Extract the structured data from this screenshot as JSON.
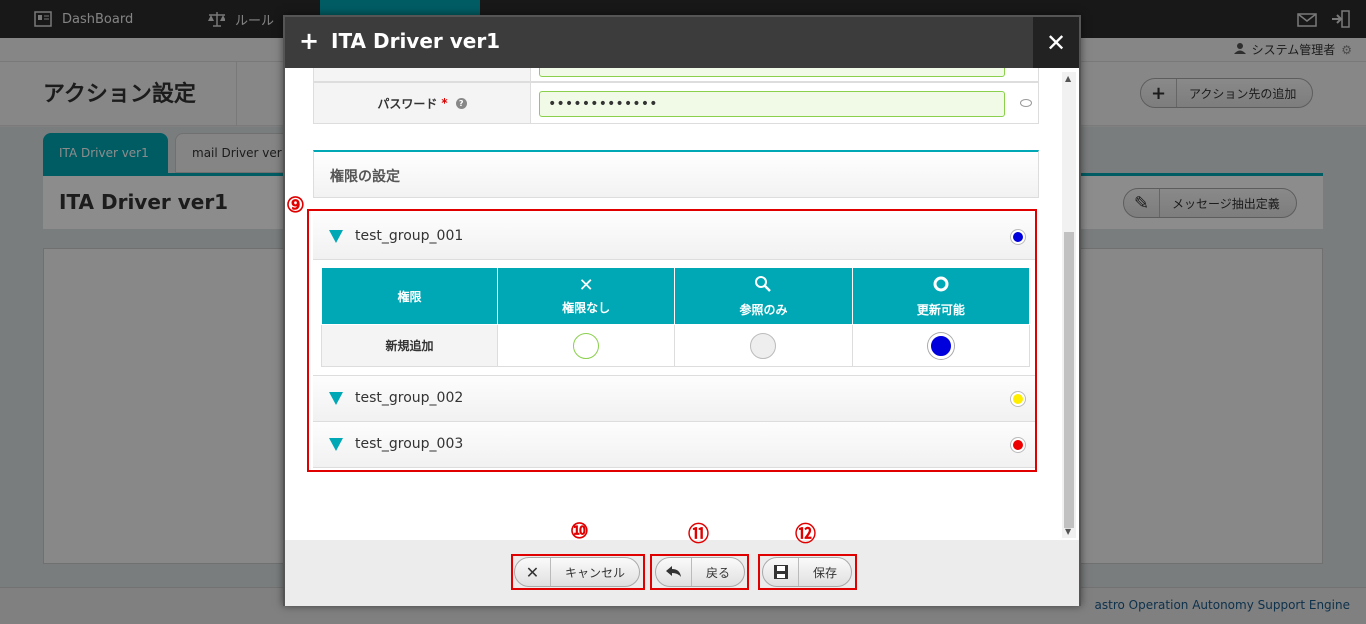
{
  "nav": {
    "dashboard": "DashBoard",
    "rule": "ルール",
    "active_item": "",
    "fourth_item": ""
  },
  "user": {
    "name": "システム管理者"
  },
  "page": {
    "title": "アクション設定",
    "add_action_button": "アクション先の追加",
    "tabs": [
      "ITA Driver ver1",
      "mail Driver ver1"
    ],
    "panel_title": "ITA Driver ver1",
    "message_button": "メッセージ抽出定義"
  },
  "footer": {
    "text": "astro Operation Autonomy Support Engine"
  },
  "modal": {
    "title": "ITA Driver ver1",
    "password_label": "パスワード",
    "required_mark": "*",
    "password_value": "•••••••••••••",
    "section_title": "権限の設定",
    "perm_header": "権限",
    "perm_none": "権限なし",
    "perm_view": "参照のみ",
    "perm_update": "更新可能",
    "perm_row_label": "新規追加",
    "groups": [
      {
        "name": "test_group_001",
        "color": "#0000dd"
      },
      {
        "name": "test_group_002",
        "color": "#ffee00"
      },
      {
        "name": "test_group_003",
        "color": "#ee0000"
      }
    ],
    "buttons": {
      "cancel": "キャンセル",
      "back": "戻る",
      "save": "保存"
    }
  },
  "markers": {
    "m9": "⑨",
    "m10": "⑩",
    "m11": "⑪",
    "m12": "⑫"
  }
}
